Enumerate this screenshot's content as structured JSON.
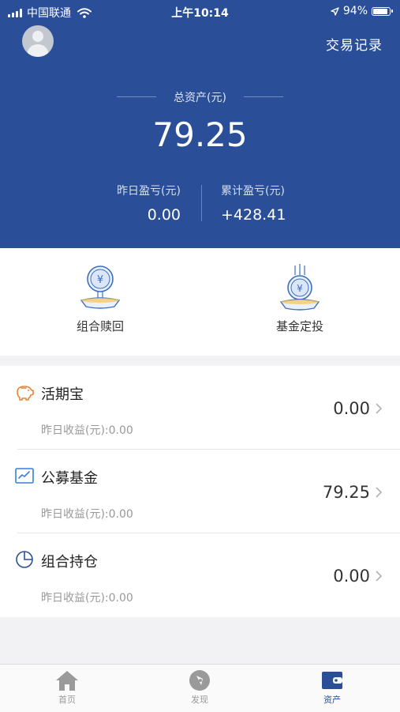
{
  "status_bar": {
    "carrier": "中国联通",
    "time": "上午10:14",
    "battery": "94%",
    "battery_level": 0.94
  },
  "header": {
    "records_label": "交易记录",
    "total_label": "总资产(元)",
    "total_value": "79.25",
    "yesterday_label": "昨日盈亏(元)",
    "yesterday_value": "0.00",
    "cumulative_label": "累计盈亏(元)",
    "cumulative_value": "+428.41"
  },
  "actions": [
    {
      "label": "组合赎回",
      "icon": "coin-fountain-icon"
    },
    {
      "label": "基金定投",
      "icon": "coin-drop-icon"
    }
  ],
  "products": [
    {
      "title": "活期宝",
      "sub": "昨日收益(元):0.00",
      "value": "0.00",
      "icon": "piggy-bank-icon",
      "color": "#e8833a"
    },
    {
      "title": "公募基金",
      "sub": "昨日收益(元):0.00",
      "value": "79.25",
      "icon": "line-chart-icon",
      "color": "#3a7fd5"
    },
    {
      "title": "组合持仓",
      "sub": "昨日收益(元):0.00",
      "value": "0.00",
      "icon": "pie-chart-icon",
      "color": "#2a4f98"
    }
  ],
  "tabs": [
    {
      "label": "首页",
      "icon": "home-icon",
      "active": false
    },
    {
      "label": "发现",
      "icon": "compass-icon",
      "active": false
    },
    {
      "label": "资产",
      "icon": "wallet-icon",
      "active": true
    }
  ],
  "colors": {
    "header_bg": "#2a4f98",
    "accent": "#2a4f98",
    "icon_gray": "#9a9a9a"
  }
}
